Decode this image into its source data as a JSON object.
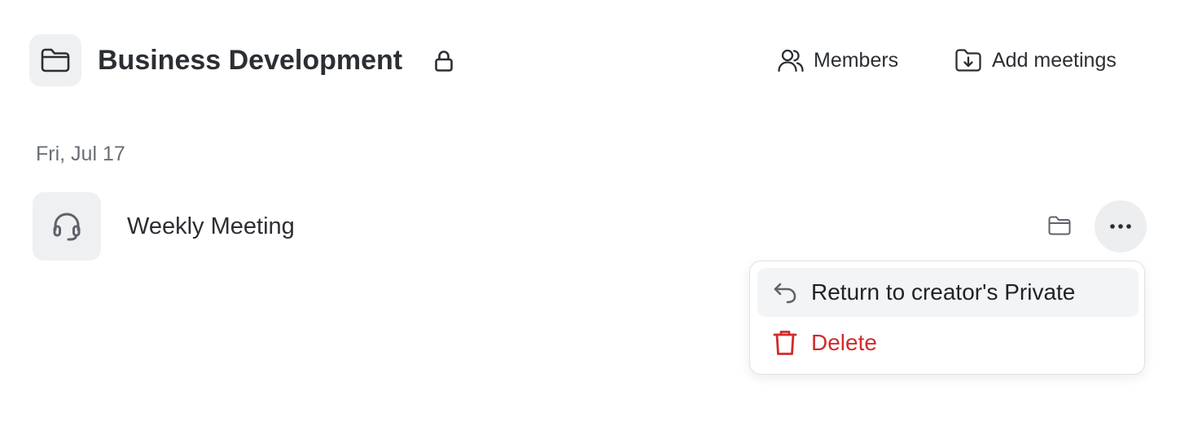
{
  "header": {
    "title": "Business Development",
    "members_label": "Members",
    "add_meetings_label": "Add meetings"
  },
  "section": {
    "date": "Fri, Jul 17"
  },
  "meeting": {
    "title": "Weekly Meeting"
  },
  "menu": {
    "return_label": "Return to creator's Private",
    "delete_label": "Delete"
  },
  "colors": {
    "badge_bg": "#eef0f2",
    "text": "#2b2f33",
    "muted": "#6a6f75",
    "danger": "#d12b2b",
    "highlight_bg": "#f3f4f5"
  },
  "icons": {
    "folder_badge": "folder-icon",
    "lock": "lock-icon",
    "members": "users-icon",
    "add_meetings": "folder-download-icon",
    "meeting": "headset-icon",
    "row_folder": "folder-icon",
    "more": "more-horizontal-icon",
    "return": "undo-arrow-icon",
    "delete": "trash-icon"
  }
}
